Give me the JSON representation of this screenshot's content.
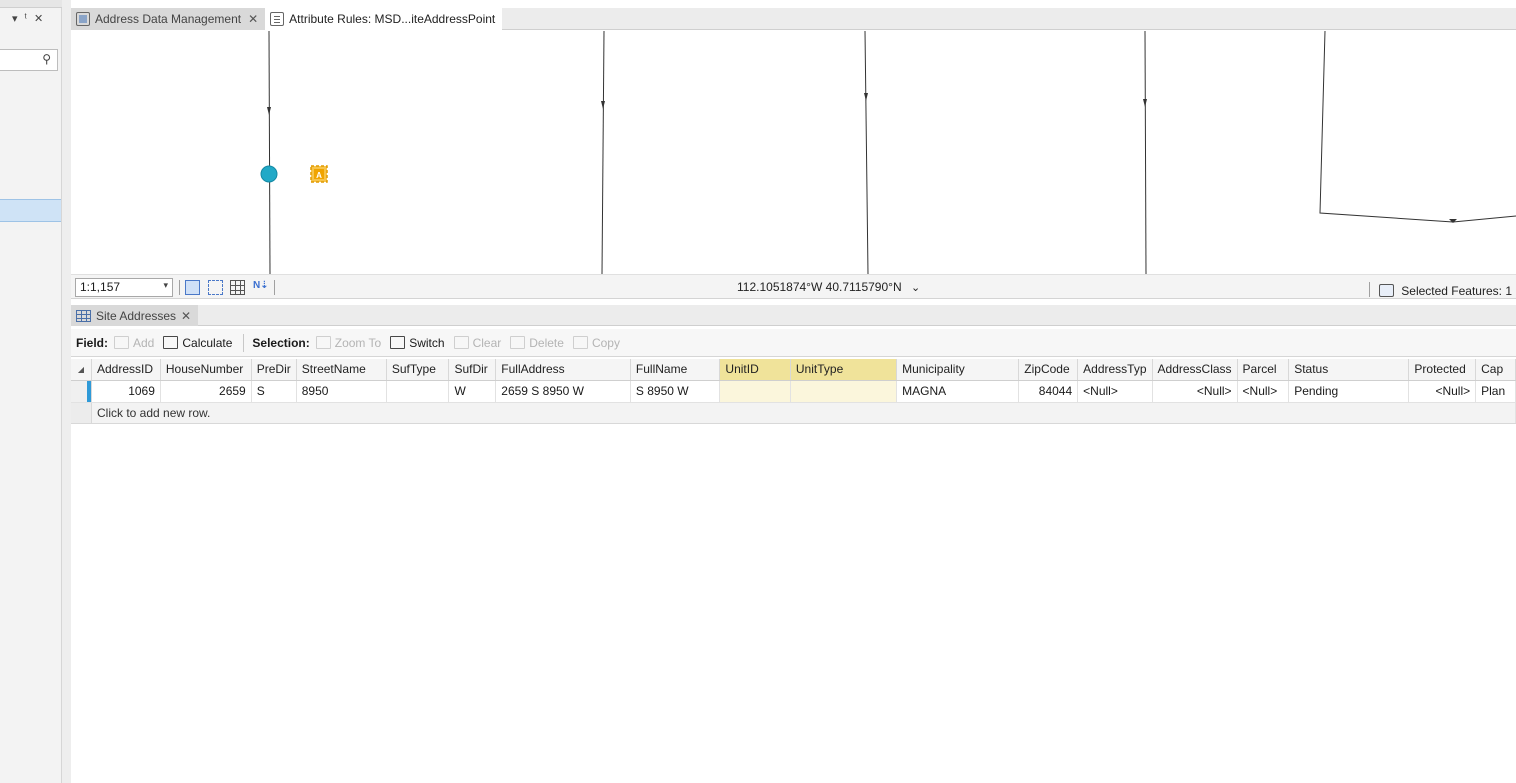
{
  "left_pane": {
    "controls": [
      "▾",
      "⊕",
      "✕"
    ],
    "search_icon": "search-icon"
  },
  "doc_tabs": [
    {
      "label": "Address Data Management",
      "icon": "map-icon",
      "active": true
    },
    {
      "label": "Attribute Rules: MSD...iteAddressPoint",
      "icon": "attribute-rules-icon",
      "active": false
    }
  ],
  "map_status": {
    "scale": "1:1,157",
    "coordinates": "112.1051874°W 40.7115790°N",
    "selected_features": "Selected Features: 1"
  },
  "table_view": {
    "tab_label": "Site Addresses",
    "toolbar": {
      "field_label": "Field:",
      "add": "Add",
      "calculate": "Calculate",
      "selection_label": "Selection:",
      "zoom_to": "Zoom To",
      "switch": "Switch",
      "clear": "Clear",
      "delete": "Delete",
      "copy": "Copy"
    },
    "columns": [
      "AddressID",
      "HouseNumber",
      "PreDir",
      "StreetName",
      "SufType",
      "SufDir",
      "FullAddress",
      "FullName",
      "UnitID",
      "UnitType",
      "Municipality",
      "ZipCode",
      "AddressTyp",
      "AddressClass",
      "Parcel",
      "Status",
      "Protected",
      "Cap"
    ],
    "rows": [
      [
        "1069",
        "2659",
        "S",
        "8950",
        "",
        "W",
        "2659 S 8950 W",
        "S 8950 W",
        "",
        "",
        "MAGNA",
        "84044",
        "<Null>",
        "<Null>",
        "<Null>",
        "Pending",
        "<Null>",
        "Plan"
      ]
    ],
    "add_row_text": "Click to add new row."
  },
  "colors": {
    "accent": "#2f9ad8",
    "highlight_column": "#f0e39a",
    "point_symbol": "#21a9c7",
    "label_symbol": "#f0a400"
  }
}
